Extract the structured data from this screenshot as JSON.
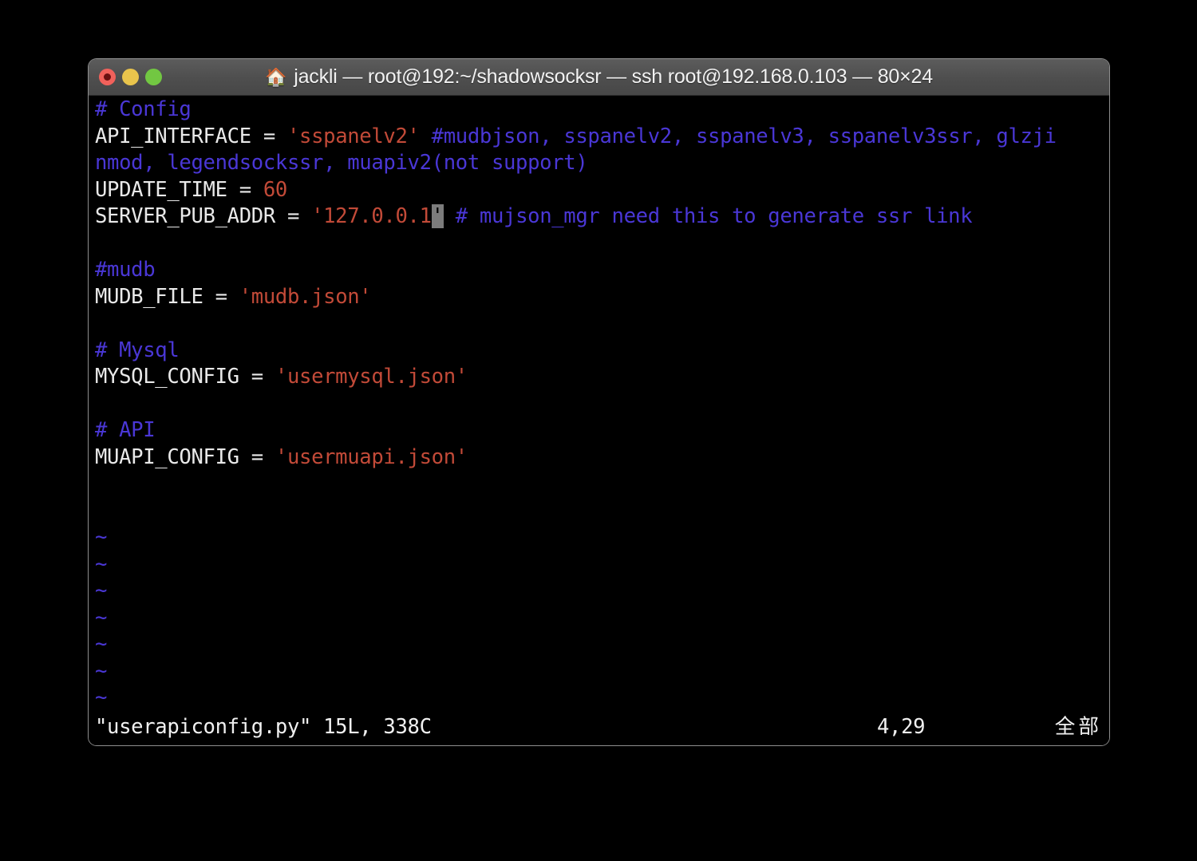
{
  "window": {
    "title": "jackli — root@192:~/shadowsocksr — ssh root@192.168.0.103 — 80×24",
    "home_icon": "🏠",
    "controls": {
      "close": "close-button",
      "minimize": "minimize-button",
      "zoom": "zoom-button"
    },
    "size": "80×24"
  },
  "colors": {
    "background": "#000000",
    "titlebar": "#4e4e4e",
    "comment": "#4a37d6",
    "string": "#c24a38",
    "text": "#e9e9e9",
    "cursor": "#7c7c7c",
    "close": "#f1615b",
    "minimize": "#e9c44c",
    "zoom": "#72c742"
  },
  "editor": {
    "lines": [
      {
        "segments": [
          {
            "t": "# Config",
            "c": "comment"
          }
        ]
      },
      {
        "segments": [
          {
            "t": "API_INTERFACE = ",
            "c": "text"
          },
          {
            "t": "'sspanelv2'",
            "c": "string"
          },
          {
            "t": " #mudbjson, sspanelv2, sspanelv3, sspanelv3ssr, glzji",
            "c": "comment"
          }
        ]
      },
      {
        "segments": [
          {
            "t": "nmod, legendsockssr, muapiv2(not support)",
            "c": "comment"
          }
        ]
      },
      {
        "segments": [
          {
            "t": "UPDATE_TIME = ",
            "c": "text"
          },
          {
            "t": "60",
            "c": "number"
          }
        ]
      },
      {
        "segments": [
          {
            "t": "SERVER_PUB_ADDR = ",
            "c": "text"
          },
          {
            "t": "'127.0.0.1",
            "c": "string"
          },
          {
            "t": "'",
            "c": "cursor"
          },
          {
            "t": " # mujson_mgr need this to generate ssr link",
            "c": "comment"
          }
        ]
      },
      {
        "segments": []
      },
      {
        "segments": [
          {
            "t": "#mudb",
            "c": "comment"
          }
        ]
      },
      {
        "segments": [
          {
            "t": "MUDB_FILE = ",
            "c": "text"
          },
          {
            "t": "'mudb.json'",
            "c": "string"
          }
        ]
      },
      {
        "segments": []
      },
      {
        "segments": [
          {
            "t": "# Mysql",
            "c": "comment"
          }
        ]
      },
      {
        "segments": [
          {
            "t": "MYSQL_CONFIG = ",
            "c": "text"
          },
          {
            "t": "'usermysql.json'",
            "c": "string"
          }
        ]
      },
      {
        "segments": []
      },
      {
        "segments": [
          {
            "t": "# API",
            "c": "comment"
          }
        ]
      },
      {
        "segments": [
          {
            "t": "MUAPI_CONFIG = ",
            "c": "text"
          },
          {
            "t": "'usermuapi.json'",
            "c": "string"
          }
        ]
      },
      {
        "segments": []
      },
      {
        "segments": []
      },
      {
        "segments": [
          {
            "t": "~",
            "c": "tilde"
          }
        ]
      },
      {
        "segments": [
          {
            "t": "~",
            "c": "tilde"
          }
        ]
      },
      {
        "segments": [
          {
            "t": "~",
            "c": "tilde"
          }
        ]
      },
      {
        "segments": [
          {
            "t": "~",
            "c": "tilde"
          }
        ]
      },
      {
        "segments": [
          {
            "t": "~",
            "c": "tilde"
          }
        ]
      },
      {
        "segments": [
          {
            "t": "~",
            "c": "tilde"
          }
        ]
      },
      {
        "segments": [
          {
            "t": "~",
            "c": "tilde"
          }
        ]
      }
    ]
  },
  "status": {
    "file": "\"userapiconfig.py\" 15L, 338C",
    "position": "4,29",
    "scroll": "全部"
  }
}
